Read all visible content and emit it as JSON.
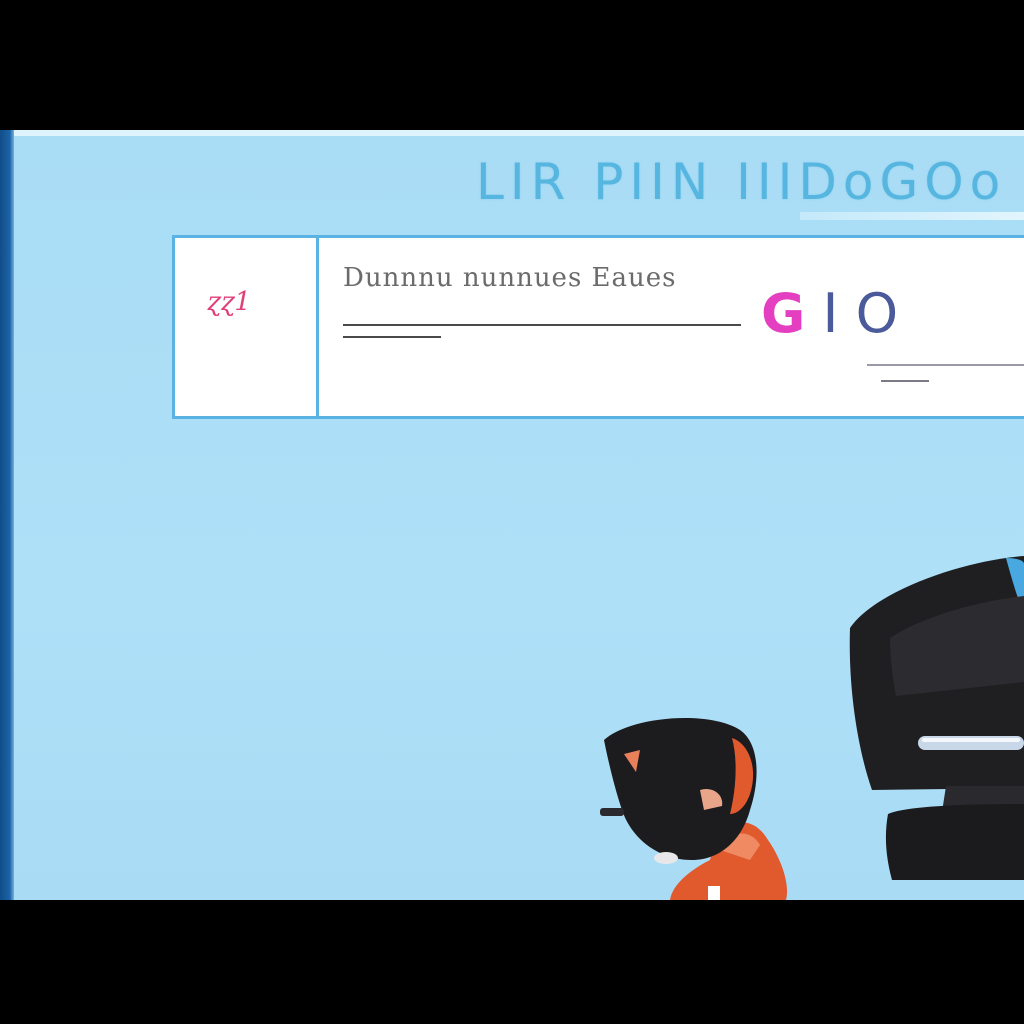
{
  "screen": {
    "header_title": "LIR PIIN IIIDoGOo"
  },
  "card": {
    "left_mark": "ɀɀ1",
    "heading": "Dunnnu nunnues Eaues",
    "code_part1": "G",
    "code_part2": "I O"
  },
  "illustration": {
    "person_icon": "person-at-computer-icon",
    "monitor_icon": "computer-monitor-icon"
  },
  "colors": {
    "background_sky": "#aee0f8",
    "accent_blue": "#5ab3e2",
    "rail_blue": "#1d63a8",
    "pink": "#e43fc0",
    "person_red": "#e05a2e",
    "dark": "#1f1f22"
  }
}
